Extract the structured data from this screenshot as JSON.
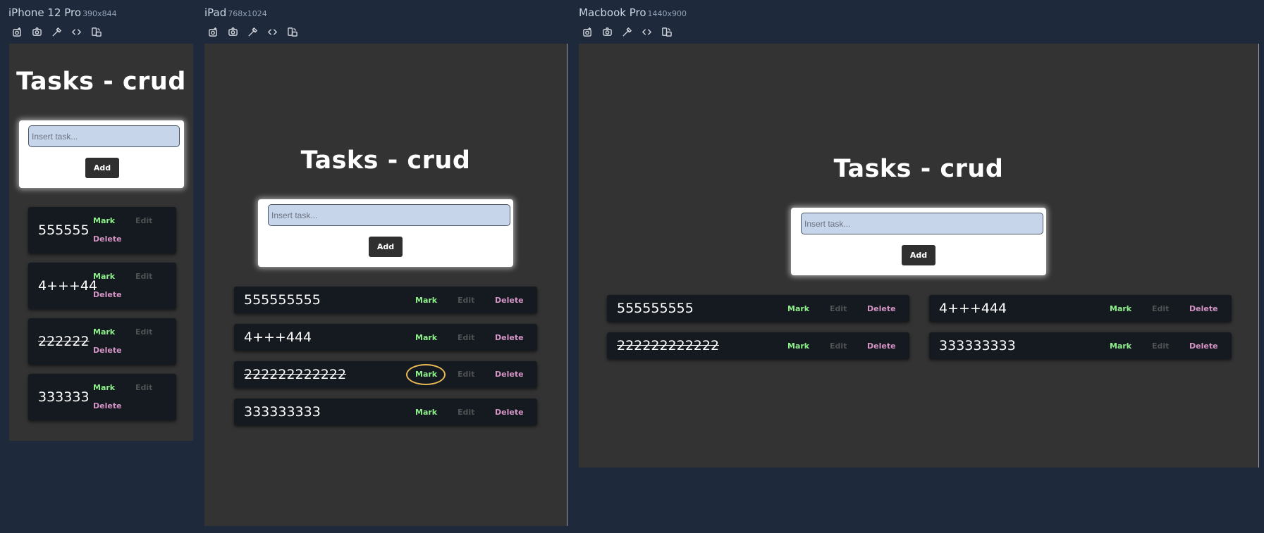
{
  "devices": [
    {
      "name": "iPhone 12 Pro",
      "dims": "390x844"
    },
    {
      "name": "iPad",
      "dims": "768x1024"
    },
    {
      "name": "Macbook Pro",
      "dims": "1440x900"
    }
  ],
  "toolbar_icons": [
    "screenshot-full-icon",
    "camera-icon",
    "eyedropper-icon",
    "code-icon",
    "rotate-device-icon"
  ],
  "app": {
    "title": "Tasks - crud",
    "input_placeholder": "Insert task...",
    "add_label": "Add",
    "mark_label": "Mark",
    "edit_label": "Edit",
    "delete_label": "Delete"
  },
  "phone_tasks": [
    {
      "text": "555555",
      "done": false
    },
    {
      "text": "4+++44",
      "done": false
    },
    {
      "text": "222222",
      "done": true
    },
    {
      "text": "333333",
      "done": false
    }
  ],
  "ipad_tasks": [
    {
      "text": "555555555",
      "done": false
    },
    {
      "text": "4+++444",
      "done": false
    },
    {
      "text": "222222222222",
      "done": true
    },
    {
      "text": "333333333",
      "done": false
    }
  ],
  "mac_tasks": [
    {
      "text": "555555555",
      "done": false
    },
    {
      "text": "4+++444",
      "done": false
    },
    {
      "text": "222222222222",
      "done": true
    },
    {
      "text": "333333333",
      "done": false
    }
  ],
  "colors": {
    "background": "#1e293b",
    "frame": "#333333",
    "task_bg": "#151a21",
    "mark": "#8ef08a",
    "edit": "#4f5252",
    "delete": "#d595c6",
    "input_bg": "#c7d5ea",
    "focus_ring": "#e8b954"
  }
}
